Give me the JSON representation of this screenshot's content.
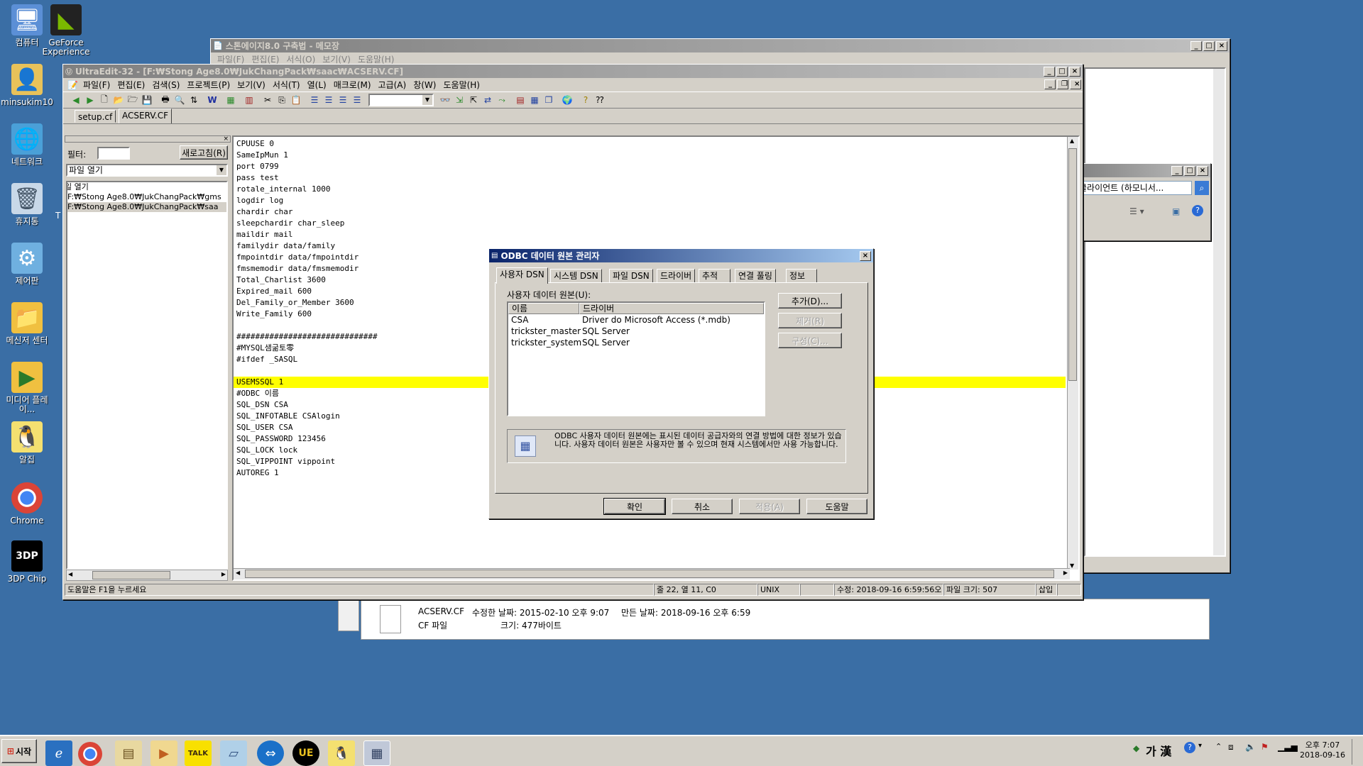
{
  "desktop": {
    "icons": [
      {
        "label": "컴퓨터"
      },
      {
        "label": "GeForce Experience"
      },
      {
        "label": "minsukim10"
      },
      {
        "label": "네트워크"
      },
      {
        "label": "휴지통"
      },
      {
        "label": "제어판"
      },
      {
        "label": "메신저 센터"
      },
      {
        "label": "미디어 플레이..."
      },
      {
        "label": "알집"
      },
      {
        "label": "Chrome"
      },
      {
        "label": "3DP Chip"
      }
    ],
    "partial_label": "T"
  },
  "notepad": {
    "title": "스톤에이지8.0 구축법 - 메모장",
    "menu": [
      "파일(F)",
      "편집(E)",
      "서식(O)",
      "보기(V)",
      "도움말(H)"
    ]
  },
  "back_window": {
    "address_text": "클라이언트 (하모니서..."
  },
  "file_info": {
    "filename": "ACSERV.CF",
    "modified": "수정한 날짜: 2015-02-10 오후 9:07",
    "created": "만든 날짜: 2018-09-16 오후 6:59",
    "type": "CF 파일",
    "size": "크기: 477바이트"
  },
  "ultraedit": {
    "title": "UltraEdit-32 - [F:₩Stong Age8.0₩JukChangPack₩saac₩ACSERV.CF]",
    "menu": [
      "파일(F)",
      "편집(E)",
      "검색(S)",
      "프로젝트(P)",
      "보기(V)",
      "서식(T)",
      "열(L)",
      "매크로(M)",
      "고급(A)",
      "창(W)",
      "도움말(H)"
    ],
    "tabs": [
      "setup.cf",
      "ACSERV.CF"
    ],
    "side": {
      "filter_label": "필터:",
      "refresh_label": "새로고침(R)",
      "combo_value": "파일 열기",
      "list": [
        "일 열기",
        "F:₩Stong Age8.0₩JukChangPack₩gms",
        "F:₩Stong Age8.0₩JukChangPack₩saa"
      ]
    },
    "code_lines": [
      "CPUUSE 0",
      "SameIpMun 1",
      "port 0799",
      "pass test",
      "rotale_internal 1000",
      "logdir log",
      "chardir char",
      "sleepchardir char_sleep",
      "maildir mail",
      "familydir data/family",
      "fmpointdir data/fmpointdir",
      "fmsmemodir data/fmsmemodir",
      "Total_Charlist 3600",
      "Expired_mail 600",
      "Del_Family_or_Member 3600",
      "Write_Family 600",
      "",
      "##############################",
      "#MYSQL샘굶토零",
      "#ifdef _SASQL",
      "",
      "USEMSSQL 1",
      "#ODBC 이름",
      "SQL_DSN CSA",
      "SQL_INFOTABLE CSAlogin",
      "SQL_USER CSA",
      "SQL_PASSWORD 123456",
      "SQL_LOCK lock",
      "SQL_VIPPOINT vippoint",
      "AUTOREG 1"
    ],
    "highlight_line": 21,
    "status": {
      "help": "도움말은 F1을 누르세요",
      "position": "줄 22, 열 11, C0",
      "format": "UNIX",
      "modified": "수정: 2018-09-16 6:59:56오",
      "filesize": "파일 크기: 507",
      "mode": "삽입"
    }
  },
  "odbc": {
    "title": "ODBC 데이터 원본 관리자",
    "tabs": [
      "사용자 DSN",
      "시스템 DSN",
      "파일 DSN",
      "드라이버",
      "추적",
      "연결 풀링",
      "정보"
    ],
    "group_label": "사용자 데이터 원본(U):",
    "col_name": "이름",
    "col_driver": "드라이버",
    "rows": [
      {
        "name": "CSA",
        "driver": "Driver do Microsoft Access (*.mdb)"
      },
      {
        "name": "trickster_master",
        "driver": "SQL Server"
      },
      {
        "name": "trickster_system",
        "driver": "SQL Server"
      }
    ],
    "add_button": "추가(D)...",
    "remove_button": "제거(R)",
    "configure_button": "구성(C)...",
    "info_text": "ODBC 사용자 데이터 원본에는 표시된 데이터 공급자와의 연결 방법에 대한 정보가 있습니다. 사용자 데이터 원본은 사용자만 볼 수 있으며 현재 시스템에서만 사용 가능합니다.",
    "ok": "확인",
    "cancel": "취소",
    "apply": "적용(A)",
    "help": "도움말"
  },
  "taskbar": {
    "start": "시작",
    "ime": "가 漢",
    "time": "오후 7:07",
    "date": "2018-09-16",
    "talk_label": "TALK",
    "ue_label": "UE"
  }
}
